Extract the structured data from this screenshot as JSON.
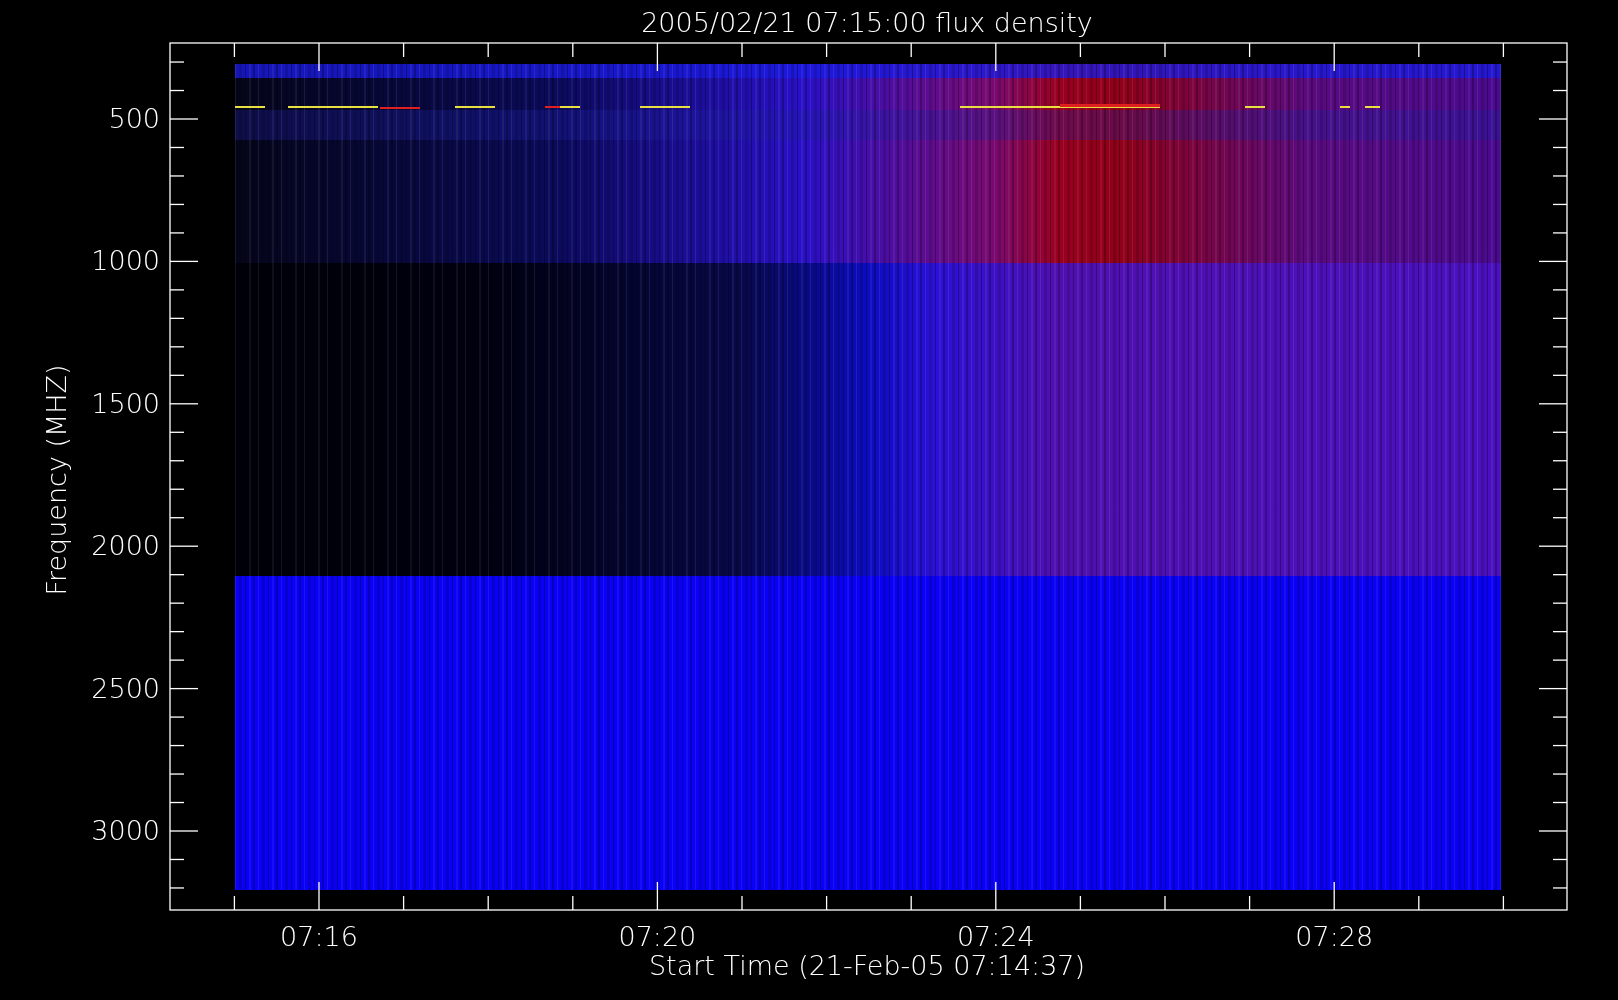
{
  "title": "2005/02/21 07:15:00 flux density",
  "y_axis": {
    "label": "Frequency (MHZ)",
    "ticks": [
      "500",
      "1000",
      "1500",
      "2000",
      "2500",
      "3000"
    ]
  },
  "x_axis": {
    "label": "Start Time (21-Feb-05 07:14:37)",
    "ticks": [
      "07:16",
      "07:20",
      "07:24",
      "07:28"
    ]
  }
}
